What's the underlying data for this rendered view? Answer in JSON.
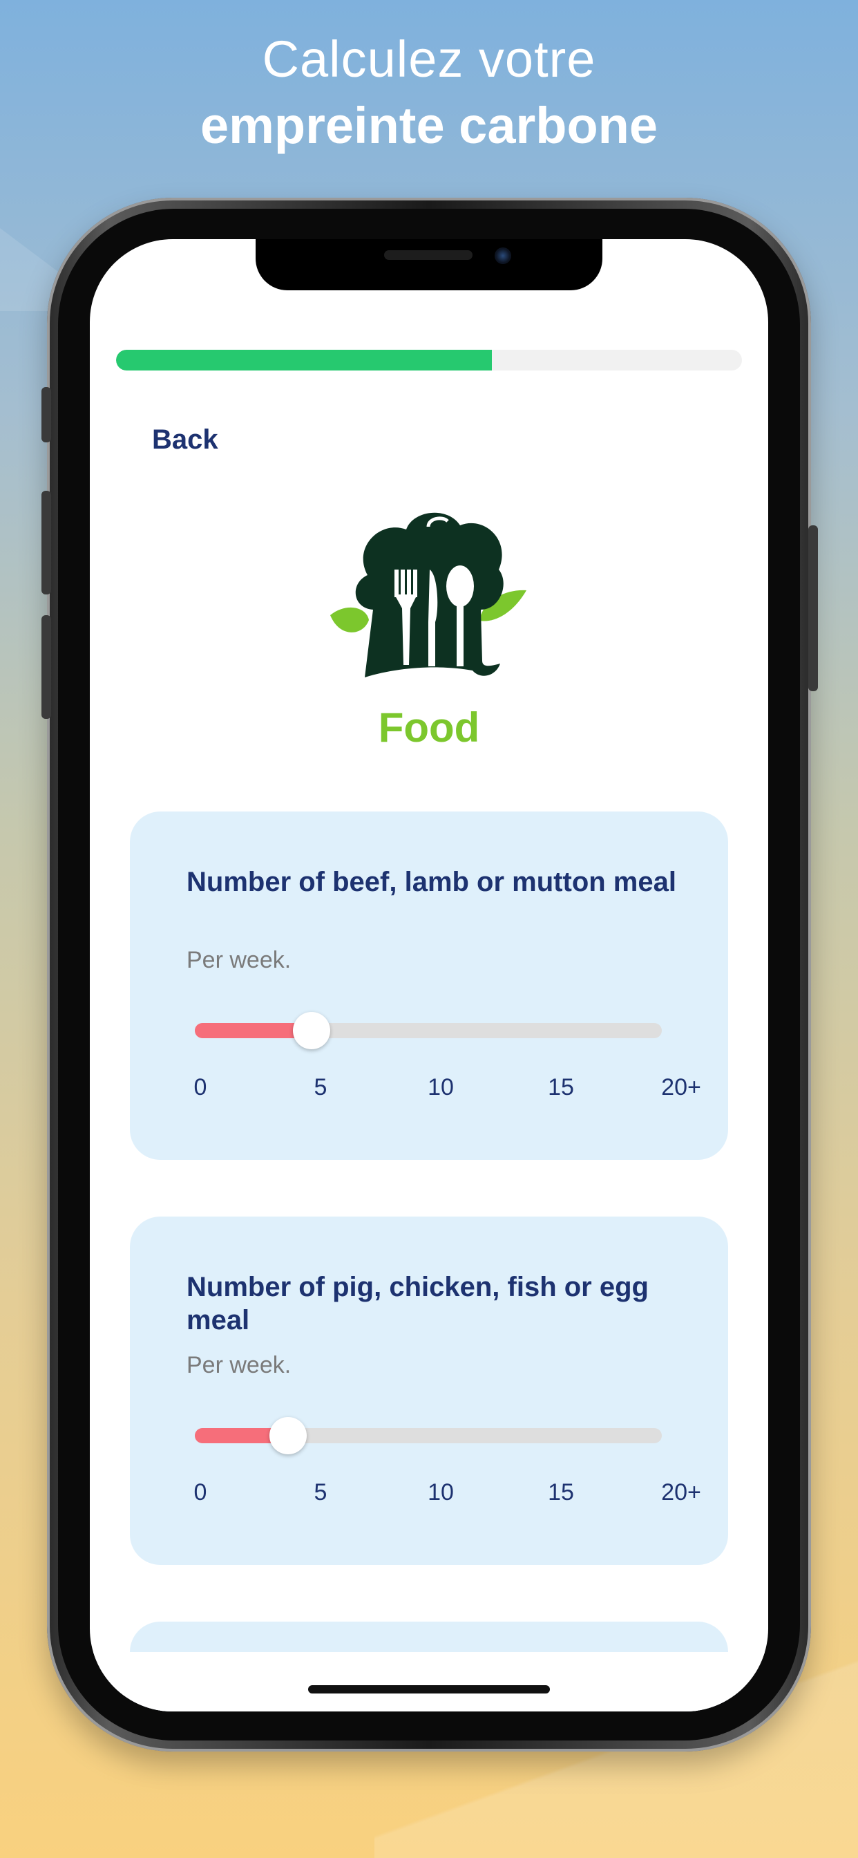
{
  "header": {
    "line1": "Calculez votre",
    "line2": "empreinte carbone"
  },
  "progress": {
    "fraction": 0.6
  },
  "nav": {
    "back_label": "Back"
  },
  "category": {
    "title": "Food",
    "icon": "chef-hat-utensils-icon"
  },
  "questions": [
    {
      "title": "Number of beef, lamb or mutton meal",
      "subtitle": "Per week.",
      "value": 5,
      "scale_max": 20,
      "ticks": [
        "0",
        "5",
        "10",
        "15",
        "20+"
      ]
    },
    {
      "title": "Number of pig, chicken, fish or egg meal",
      "subtitle": "Per week.",
      "value": 4,
      "scale_max": 20,
      "ticks": [
        "0",
        "5",
        "10",
        "15",
        "20+"
      ]
    }
  ],
  "colors": {
    "progress": "#26c96f",
    "slider_fill": "#f66e7a",
    "card_bg": "#dff0fb",
    "title_text": "#1d3270",
    "category_title": "#7cc72d",
    "logo_dark": "#0d3121",
    "logo_leaf": "#7cc72d"
  }
}
